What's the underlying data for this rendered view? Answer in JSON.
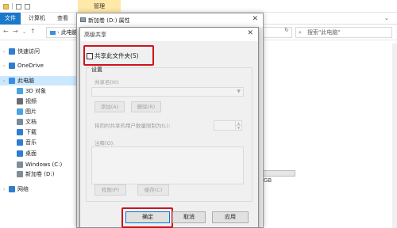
{
  "explorer": {
    "ribbon_manage_tab": "管理",
    "ribbon_tabs": [
      "文件",
      "计算机",
      "查看"
    ],
    "address_path": "此电脑",
    "address_short": "此电脑",
    "search_placeholder": "搜索\"此电脑\"",
    "sidebar": [
      {
        "label": "快速访问",
        "icon": "star-icon",
        "color": "#2f7dd1"
      },
      {
        "label": "OneDrive",
        "icon": "cloud-icon",
        "color": "#2f7dd1"
      },
      {
        "label": "此电脑",
        "icon": "computer-icon",
        "color": "#3a8ee6",
        "selected": true
      },
      {
        "label": "3D 对象",
        "icon": "3d-objects-icon",
        "color": "#4aa3e0"
      },
      {
        "label": "视频",
        "icon": "video-icon",
        "color": "#6d6d6d"
      },
      {
        "label": "图片",
        "icon": "pictures-icon",
        "color": "#4aa3e0"
      },
      {
        "label": "文档",
        "icon": "documents-icon",
        "color": "#7a8a99"
      },
      {
        "label": "下载",
        "icon": "download-icon",
        "color": "#2f7dd1"
      },
      {
        "label": "音乐",
        "icon": "music-icon",
        "color": "#2f7dd1"
      },
      {
        "label": "桌面",
        "icon": "desktop-icon",
        "color": "#2f7dd1"
      },
      {
        "label": "Windows (C:)",
        "icon": "drive-icon",
        "color": "#7f8c99"
      },
      {
        "label": "新加卷 (D:)",
        "icon": "drive-icon",
        "color": "#7f8c99"
      },
      {
        "label": "网络",
        "icon": "network-icon",
        "color": "#2f7dd1"
      }
    ],
    "disk_size_text": "GB"
  },
  "properties_window": {
    "title": "新加卷 (D:) 属性"
  },
  "advanced_sharing": {
    "title": "高级共享",
    "share_checkbox_label": "共享此文件夹(S)",
    "share_checked": false,
    "settings_label": "设置",
    "share_name_label": "共享名(H):",
    "add_button": "添加(A)",
    "remove_button": "删除(R)",
    "user_limit_label": "将同时共享的用户数量限制为(L):",
    "comment_label": "注释(O):",
    "permissions_button": "权限(P)",
    "caching_button": "缓存(C)",
    "ok_button": "确定",
    "cancel_button": "取消",
    "apply_button": "应用"
  },
  "colors": {
    "highlight_red": "#d0121b",
    "accent_blue": "#0078d7",
    "manage_tab_bg": "#ffe9a8"
  }
}
